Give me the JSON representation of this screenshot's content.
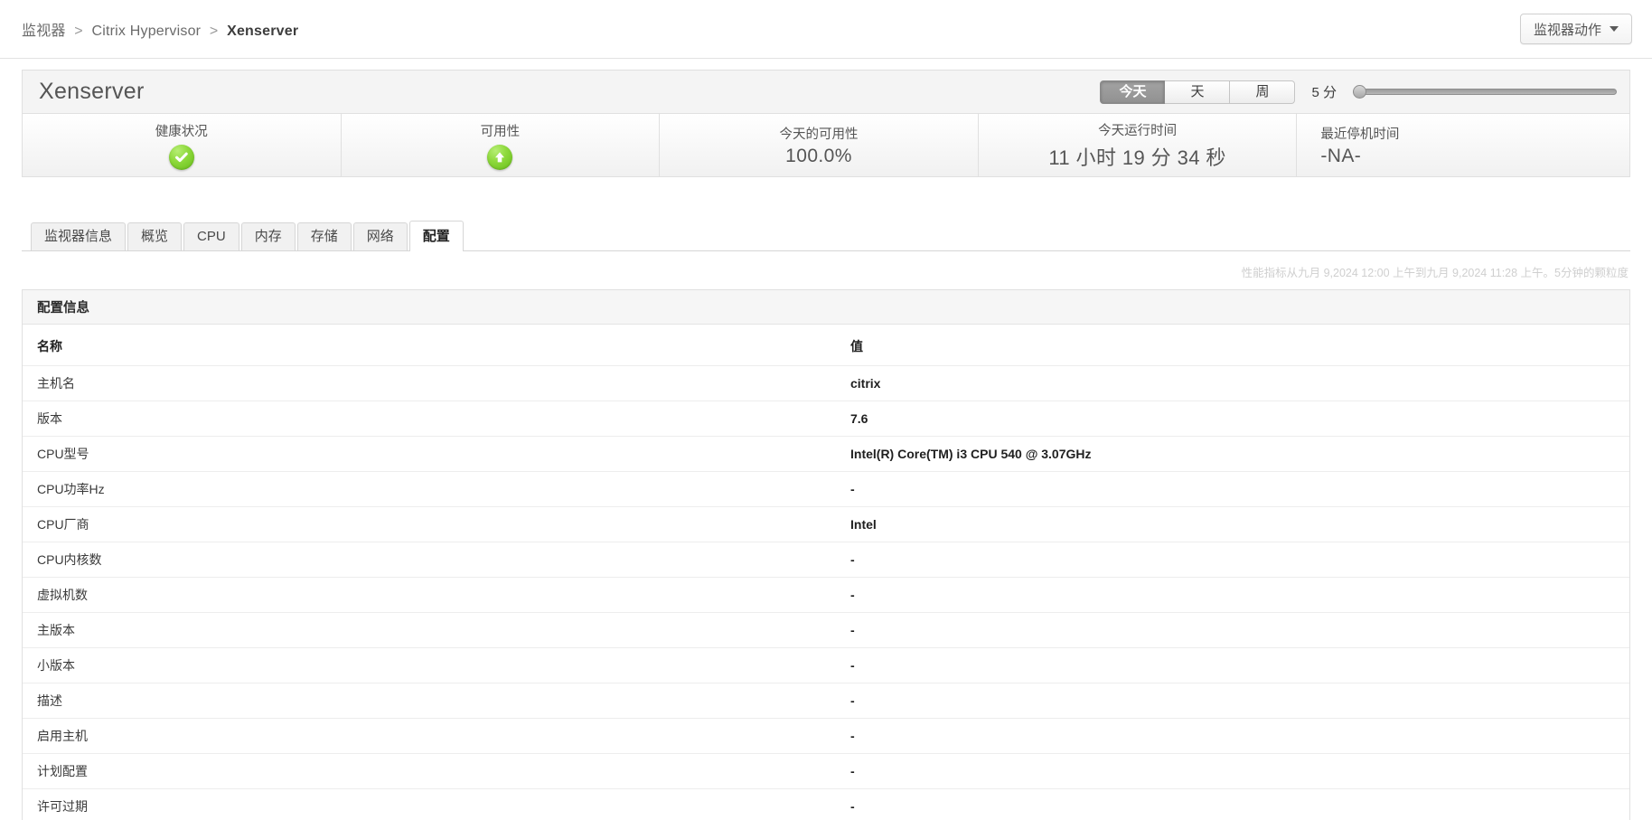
{
  "breadcrumb": {
    "items": [
      "监视器",
      "Citrix Hypervisor",
      "Xenserver"
    ],
    "separator": ">"
  },
  "header": {
    "actions_button_label": "监视器动作",
    "actions_caret_icon": "chevron-down-icon"
  },
  "title_row": {
    "page_title": "Xenserver",
    "range_buttons": [
      {
        "label": "今天",
        "active": true
      },
      {
        "label": "天",
        "active": false
      },
      {
        "label": "周",
        "active": false
      }
    ],
    "granularity_label": "5 分",
    "slider": {
      "value": 0,
      "min": 0,
      "max": 100
    }
  },
  "cards": [
    {
      "label": "健康状况",
      "value": "",
      "icon": "green-check-circle-icon",
      "align": "center"
    },
    {
      "label": "可用性",
      "value": "",
      "icon": "green-up-arrow-circle-icon",
      "align": "center"
    },
    {
      "label": "今天的可用性",
      "value": "100.0%",
      "icon": "",
      "align": "center"
    },
    {
      "label": "今天运行时间",
      "value": "11 小时 19 分 34 秒",
      "icon": "",
      "align": "center"
    },
    {
      "label": "最近停机时间",
      "value": "-NA-",
      "icon": "",
      "align": "left"
    }
  ],
  "tabs": [
    {
      "label": "监视器信息",
      "active": false
    },
    {
      "label": "概览",
      "active": false
    },
    {
      "label": "CPU",
      "active": false
    },
    {
      "label": "内存",
      "active": false
    },
    {
      "label": "存储",
      "active": false
    },
    {
      "label": "网络",
      "active": false
    },
    {
      "label": "配置",
      "active": true
    }
  ],
  "meta_note": "性能指标从九月 9,2024 12:00 上午到九月 9,2024 11:28 上午。5分钟的颗粒度",
  "panel": {
    "title": "配置信息",
    "columns": [
      "名称",
      "值"
    ],
    "rows": [
      {
        "name": "主机名",
        "value": "citrix"
      },
      {
        "name": "版本",
        "value": "7.6"
      },
      {
        "name": "CPU型号",
        "value": "Intel(R) Core(TM) i3 CPU 540 @ 3.07GHz"
      },
      {
        "name": "CPU功率Hz",
        "value": "-"
      },
      {
        "name": "CPU厂商",
        "value": "Intel"
      },
      {
        "name": "CPU内核数",
        "value": "-"
      },
      {
        "name": "虚拟机数",
        "value": "-"
      },
      {
        "name": "主版本",
        "value": "-"
      },
      {
        "name": "小版本",
        "value": "-"
      },
      {
        "name": "描述",
        "value": "-"
      },
      {
        "name": "启用主机",
        "value": "-"
      },
      {
        "name": "计划配置",
        "value": "-"
      },
      {
        "name": "许可过期",
        "value": "-"
      }
    ]
  },
  "colors": {
    "status_green": "#8ed93c",
    "active_tab_bg": "#ffffff",
    "panel_head_bg": "#f6f6f6"
  }
}
